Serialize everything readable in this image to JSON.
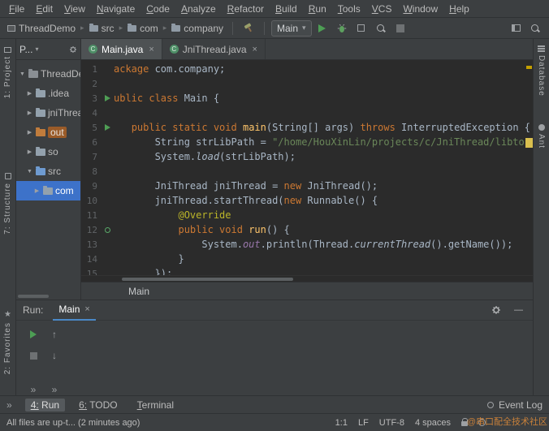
{
  "menu": [
    "File",
    "Edit",
    "View",
    "Navigate",
    "Code",
    "Analyze",
    "Refactor",
    "Build",
    "Run",
    "Tools",
    "VCS",
    "Window",
    "Help"
  ],
  "toolbar": {
    "path": [
      "ThreadDemo",
      "src",
      "com",
      "company"
    ],
    "run_config": "Main"
  },
  "stripes": {
    "left": [
      {
        "label": "1: Project",
        "icon": "project"
      },
      {
        "label": "7: Structure",
        "icon": "structure"
      },
      {
        "label": "2: Favorites",
        "icon": "star"
      }
    ],
    "right": [
      {
        "label": "Database",
        "icon": "database"
      },
      {
        "label": "Ant",
        "icon": "ant"
      }
    ]
  },
  "project": {
    "tab": "P...",
    "items": [
      {
        "label": "ThreadDemo",
        "indent": 0,
        "arrow": "expanded",
        "type": "root",
        "selected": false
      },
      {
        "label": ".idea",
        "indent": 1,
        "arrow": "collapsed",
        "type": "folder",
        "selected": false
      },
      {
        "label": "jniThread",
        "indent": 1,
        "arrow": "collapsed",
        "type": "folder",
        "selected": false
      },
      {
        "label": "out",
        "indent": 1,
        "arrow": "collapsed",
        "type": "excluded",
        "selected": false
      },
      {
        "label": "so",
        "indent": 1,
        "arrow": "collapsed",
        "type": "folder",
        "selected": false
      },
      {
        "label": "src",
        "indent": 1,
        "arrow": "expanded",
        "type": "src",
        "selected": false
      },
      {
        "label": "com",
        "indent": 2,
        "arrow": "collapsed",
        "type": "folder",
        "selected": true
      }
    ]
  },
  "editor": {
    "tabs": [
      {
        "label": "Main.java",
        "active": true
      },
      {
        "label": "JniThread.java",
        "active": false
      }
    ],
    "breadcrumb": "Main",
    "lines": [
      {
        "n": 1,
        "t": [
          [
            "ackage",
            "kw"
          ],
          [
            " com.company;",
            "pl"
          ]
        ]
      },
      {
        "n": 2,
        "t": []
      },
      {
        "n": 3,
        "g": "run",
        "t": [
          [
            "ublic class ",
            "kw"
          ],
          [
            "Main ",
            "pl"
          ],
          [
            "{",
            "pl"
          ]
        ]
      },
      {
        "n": 4,
        "t": []
      },
      {
        "n": 5,
        "g": "run",
        "t": [
          [
            "   ",
            "pl"
          ],
          [
            "public static void ",
            "kw"
          ],
          [
            "main",
            "fn"
          ],
          [
            "(String[] args) ",
            "pl"
          ],
          [
            "throws",
            "kw"
          ],
          [
            " InterruptedException {",
            "pl"
          ]
        ]
      },
      {
        "n": 6,
        "hl": true,
        "t": [
          [
            "       String strLibPath = ",
            "pl"
          ],
          [
            "\"/home/HouXinLin/projects/c/JniThread/libto",
            "str"
          ]
        ]
      },
      {
        "n": 7,
        "t": [
          [
            "       System.",
            "pl"
          ],
          [
            "load",
            "it"
          ],
          [
            "(strLibPath);",
            "pl"
          ]
        ]
      },
      {
        "n": 8,
        "t": []
      },
      {
        "n": 9,
        "t": [
          [
            "       JniThread jniThread = ",
            "pl"
          ],
          [
            "new",
            "kw"
          ],
          [
            " JniThread();",
            "pl"
          ]
        ]
      },
      {
        "n": 10,
        "t": [
          [
            "       jniThread.startThread(",
            "pl"
          ],
          [
            "new",
            "kw"
          ],
          [
            " Runnable() {",
            "pl"
          ]
        ]
      },
      {
        "n": 11,
        "t": [
          [
            "           @Override",
            "ann"
          ]
        ]
      },
      {
        "n": 12,
        "g": "ovr",
        "t": [
          [
            "           ",
            "pl"
          ],
          [
            "public void ",
            "kw"
          ],
          [
            "run",
            "fn"
          ],
          [
            "() {",
            "pl"
          ]
        ]
      },
      {
        "n": 13,
        "t": [
          [
            "               System.",
            "pl"
          ],
          [
            "out",
            "fld"
          ],
          [
            ".println(Thread.",
            "pl"
          ],
          [
            "currentThread",
            "it"
          ],
          [
            "().getName());",
            "pl"
          ]
        ]
      },
      {
        "n": 14,
        "t": [
          [
            "           }",
            "pl"
          ]
        ]
      },
      {
        "n": 15,
        "t": [
          [
            "       });",
            "pl"
          ]
        ]
      }
    ]
  },
  "run_panel": {
    "label": "Run:",
    "tab": "Main"
  },
  "toolbuttons": {
    "left": [
      "4: Run",
      "6: TODO",
      "Terminal"
    ],
    "right": "Event Log"
  },
  "statusbar": {
    "message": "All files are up-t... (2 minutes ago)",
    "caret": "1:1",
    "line_ending": "LF",
    "encoding": "UTF-8",
    "indent": "4 spaces",
    "watermark": "@串口配全技术社区"
  }
}
